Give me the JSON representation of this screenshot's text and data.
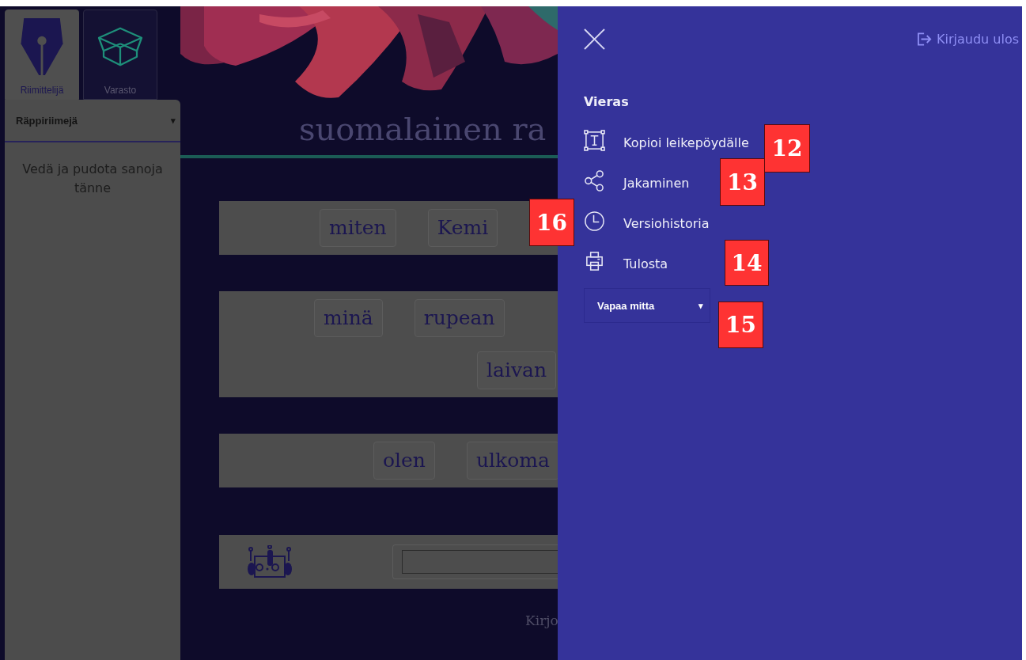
{
  "sidebar": {
    "tabs": [
      {
        "label": "Riimittelijä",
        "kind": "pen",
        "selected": true
      },
      {
        "label": "Varasto",
        "kind": "box",
        "selected": false
      }
    ],
    "dropdown": {
      "value": "Räppiriimejä",
      "caret": "▾"
    },
    "drop_hint": "Vedä ja pudota sanoja tänne"
  },
  "main": {
    "title": "suomalainen ra",
    "rows": [
      {
        "lines": [
          [
            "miten",
            "Kemi"
          ]
        ]
      },
      {
        "lines": [
          [
            "minä",
            "rupean"
          ],
          [
            "laivan"
          ]
        ]
      },
      {
        "lines": [
          [
            "olen",
            "ulkoma"
          ]
        ]
      }
    ],
    "footer": "Kirjo"
  },
  "drawer": {
    "logout": "Kirjaudu ulos",
    "user": "Vieras",
    "items": [
      {
        "label": "Kopioi leikepöydälle",
        "kind": "copy"
      },
      {
        "label": "Jakaminen",
        "kind": "share"
      },
      {
        "label": "Versiohistoria",
        "kind": "history"
      },
      {
        "label": "Tulosta",
        "kind": "print"
      }
    ],
    "meter_select": {
      "value": "Vapaa mitta",
      "caret": "▾"
    }
  },
  "annotations": [
    "12",
    "13",
    "14",
    "15",
    "16"
  ]
}
